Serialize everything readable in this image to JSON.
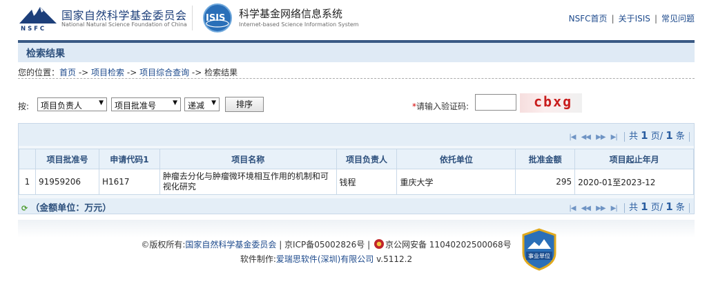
{
  "header": {
    "org_name_cn": "国家自然科学基金委员会",
    "org_name_en": "National Natural Science Foundation of China",
    "nsfc_logo_text": "N S F C",
    "isis_logo_text": "ISIS",
    "system_name_cn": "科学基金网络信息系统",
    "system_name_en": "Internet-based Science Information System",
    "links": [
      "NSFC首页",
      "关于ISIS",
      "常见问题"
    ],
    "link_separator": "|"
  },
  "section_title": "检索结果",
  "breadcrumb": {
    "prefix": "您的位置：",
    "items": [
      "首页",
      "项目检索",
      "项目综合查询"
    ],
    "separator": " -> ",
    "current": "检索结果"
  },
  "sort": {
    "label": "按:",
    "field1": "项目负责人",
    "field2": "项目批准号",
    "order": "递减",
    "button": "排序"
  },
  "captcha": {
    "required_mark": "*",
    "label": "请输入验证码:",
    "input_value": "",
    "image_text": "cbxg"
  },
  "pager": {
    "prefix": "共",
    "pages": "1",
    "pages_unit": "页/",
    "count": "1",
    "count_unit": "条"
  },
  "table": {
    "headers": [
      "项目批准号",
      "申请代码1",
      "项目名称",
      "项目负责人",
      "依托单位",
      "批准金额",
      "项目起止年月"
    ],
    "rows": [
      {
        "index": "1",
        "approval_no": "91959206",
        "code": "H1617",
        "name": "肿瘤去分化与肿瘤微环境相互作用的机制和可视化研究",
        "leader": "钱程",
        "institution": "重庆大学",
        "amount": "295",
        "period": "2020-01至2023-12"
      }
    ]
  },
  "amount_unit_note": "（金额单位：万元）",
  "footer": {
    "copyright_prefix": "©版权所有:",
    "copyright_org": "国家自然科学基金委员会",
    "icp": "| 京ICP备05002826号 |",
    "police": "京公网安备 11040202500068号",
    "software_prefix": "软件制作:",
    "software_company": "爱瑞思软件(深圳)有限公司",
    "version": "v.5112.2",
    "badge_text": "事业单位"
  },
  "colors": {
    "brand_blue": "#1d3f7a",
    "title_bar_bg": "#dfeaf5",
    "title_bar_border": "#3a5a84",
    "link": "#1d4a8c",
    "captcha_text": "#c81d1d"
  }
}
